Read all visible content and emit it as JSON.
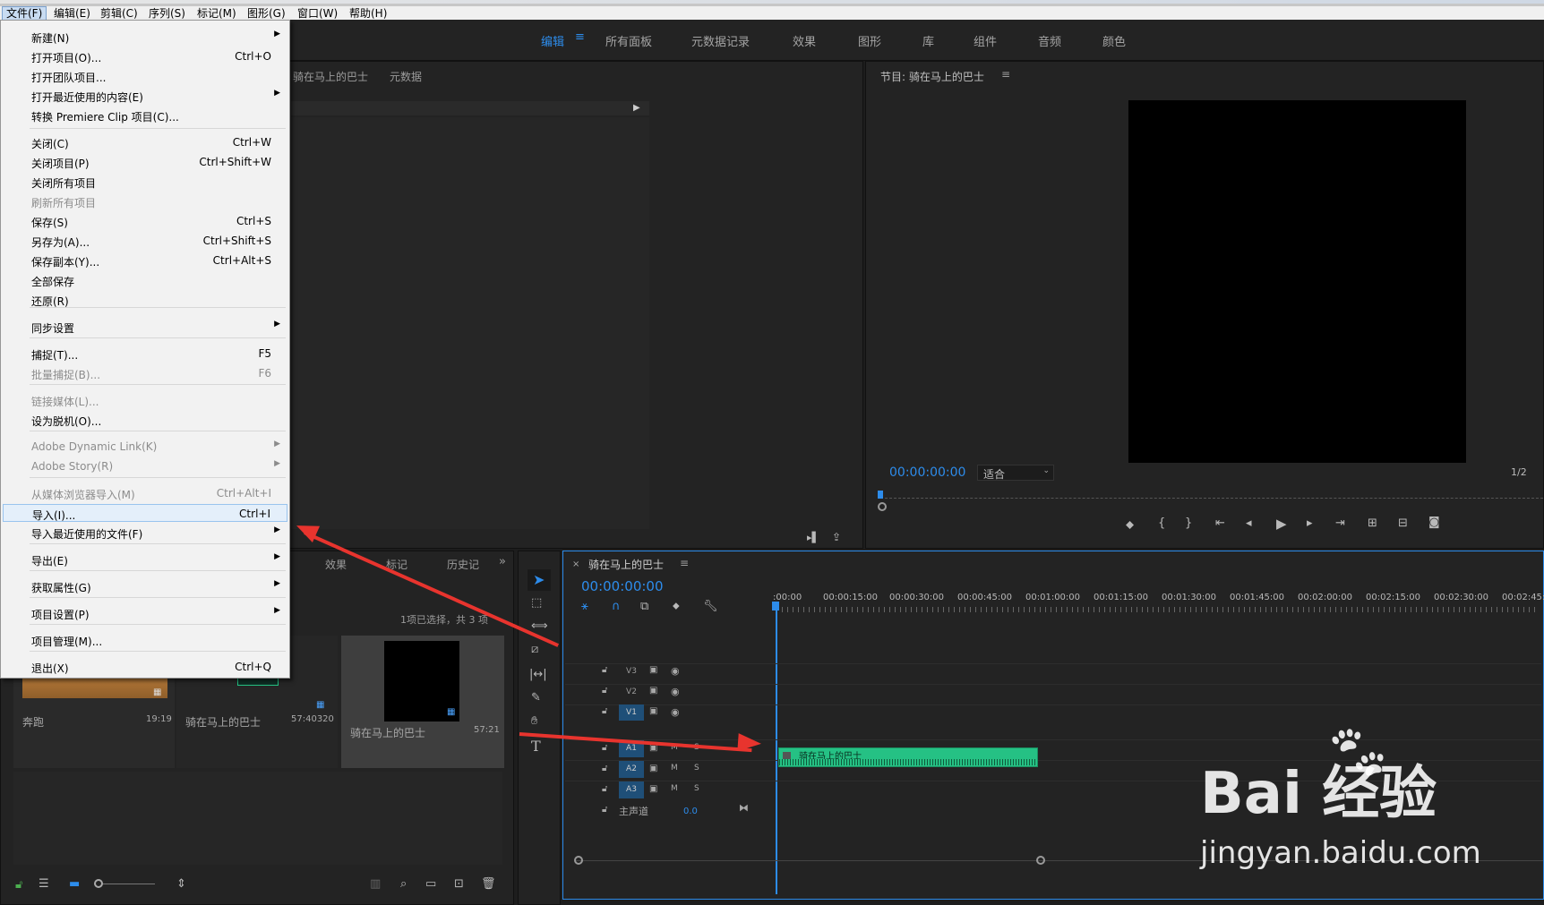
{
  "menubar": {
    "items": [
      "文件(F)",
      "编辑(E)",
      "剪辑(C)",
      "序列(S)",
      "标记(M)",
      "图形(G)",
      "窗口(W)",
      "帮助(H)"
    ]
  },
  "workspaces": [
    "编辑",
    "所有面板",
    "元数据记录",
    "效果",
    "图形",
    "库",
    "组件",
    "音频",
    "颜色"
  ],
  "source_panel": {
    "tab1": "骑在马上的巴士",
    "tab2": "元数据"
  },
  "program_monitor": {
    "title": "节目: 骑在马上的巴士",
    "timecode": "00:00:00:00",
    "fit": "适合",
    "resolution": "1/2"
  },
  "file_menu": {
    "items": [
      {
        "label": "新建(N)",
        "shortcut": "",
        "submenu": true,
        "disabled": false
      },
      {
        "label": "打开项目(O)...",
        "shortcut": "Ctrl+O",
        "submenu": false,
        "disabled": false
      },
      {
        "label": "打开团队项目...",
        "shortcut": "",
        "submenu": false,
        "disabled": false
      },
      {
        "label": "打开最近使用的内容(E)",
        "shortcut": "",
        "submenu": true,
        "disabled": false
      },
      {
        "label": "转换 Premiere Clip 项目(C)...",
        "shortcut": "",
        "submenu": false,
        "disabled": false
      },
      {
        "label": "关闭(C)",
        "shortcut": "Ctrl+W",
        "submenu": false,
        "disabled": false
      },
      {
        "label": "关闭项目(P)",
        "shortcut": "Ctrl+Shift+W",
        "submenu": false,
        "disabled": false
      },
      {
        "label": "关闭所有项目",
        "shortcut": "",
        "submenu": false,
        "disabled": false
      },
      {
        "label": "刷新所有项目",
        "shortcut": "",
        "submenu": false,
        "disabled": true
      },
      {
        "label": "保存(S)",
        "shortcut": "Ctrl+S",
        "submenu": false,
        "disabled": false
      },
      {
        "label": "另存为(A)...",
        "shortcut": "Ctrl+Shift+S",
        "submenu": false,
        "disabled": false
      },
      {
        "label": "保存副本(Y)...",
        "shortcut": "Ctrl+Alt+S",
        "submenu": false,
        "disabled": false
      },
      {
        "label": "全部保存",
        "shortcut": "",
        "submenu": false,
        "disabled": false
      },
      {
        "label": "还原(R)",
        "shortcut": "",
        "submenu": false,
        "disabled": false
      },
      {
        "label": "同步设置",
        "shortcut": "",
        "submenu": true,
        "disabled": false
      },
      {
        "label": "捕捉(T)...",
        "shortcut": "F5",
        "submenu": false,
        "disabled": false
      },
      {
        "label": "批量捕捉(B)...",
        "shortcut": "F6",
        "submenu": false,
        "disabled": true
      },
      {
        "label": "链接媒体(L)...",
        "shortcut": "",
        "submenu": false,
        "disabled": true
      },
      {
        "label": "设为脱机(O)...",
        "shortcut": "",
        "submenu": false,
        "disabled": false
      },
      {
        "label": "Adobe Dynamic Link(K)",
        "shortcut": "",
        "submenu": true,
        "disabled": true
      },
      {
        "label": "Adobe Story(R)",
        "shortcut": "",
        "submenu": true,
        "disabled": true
      },
      {
        "label": "从媒体浏览器导入(M)",
        "shortcut": "Ctrl+Alt+I",
        "submenu": false,
        "disabled": true
      },
      {
        "label": "导入(I)...",
        "shortcut": "Ctrl+I",
        "submenu": false,
        "disabled": false,
        "highlighted": true
      },
      {
        "label": "导入最近使用的文件(F)",
        "shortcut": "",
        "submenu": true,
        "disabled": false
      },
      {
        "label": "导出(E)",
        "shortcut": "",
        "submenu": true,
        "disabled": false
      },
      {
        "label": "获取属性(G)",
        "shortcut": "",
        "submenu": true,
        "disabled": false
      },
      {
        "label": "项目设置(P)",
        "shortcut": "",
        "submenu": true,
        "disabled": false
      },
      {
        "label": "项目管理(M)...",
        "shortcut": "",
        "submenu": false,
        "disabled": false
      },
      {
        "label": "退出(X)",
        "shortcut": "Ctrl+Q",
        "submenu": false,
        "disabled": false
      }
    ]
  },
  "project_panel": {
    "tabs": [
      "效果",
      "标记",
      "历史记"
    ],
    "selection": "1项已选择，共 3 项",
    "clips": [
      {
        "name": "奔跑",
        "duration": "19:19"
      },
      {
        "name": "骑在马上的巴士",
        "duration": "57:40320"
      },
      {
        "name": "骑在马上的巴士",
        "duration": "57:21"
      }
    ]
  },
  "timeline": {
    "title": "骑在马上的巴士",
    "timecode": "00:00:00:00",
    "ruler": [
      ":00:00",
      "00:00:15:00",
      "00:00:30:00",
      "00:00:45:00",
      "00:01:00:00",
      "00:01:15:00",
      "00:01:30:00",
      "00:01:45:00",
      "00:02:00:00",
      "00:02:15:00",
      "00:02:30:00",
      "00:02:45:00"
    ],
    "video_tracks": [
      "V3",
      "V2",
      "V1"
    ],
    "audio_tracks": [
      "A1",
      "A2",
      "A3"
    ],
    "master": {
      "label": "主声道",
      "value": "0.0"
    },
    "clip_label": "骑在马上的巴士"
  },
  "watermark": {
    "brand": "Bai 经验",
    "url": "jingyan.baidu.com"
  },
  "colors": {
    "accent": "#2d8ceb",
    "arrow": "#e8342e",
    "audio_clip": "#25c184"
  }
}
